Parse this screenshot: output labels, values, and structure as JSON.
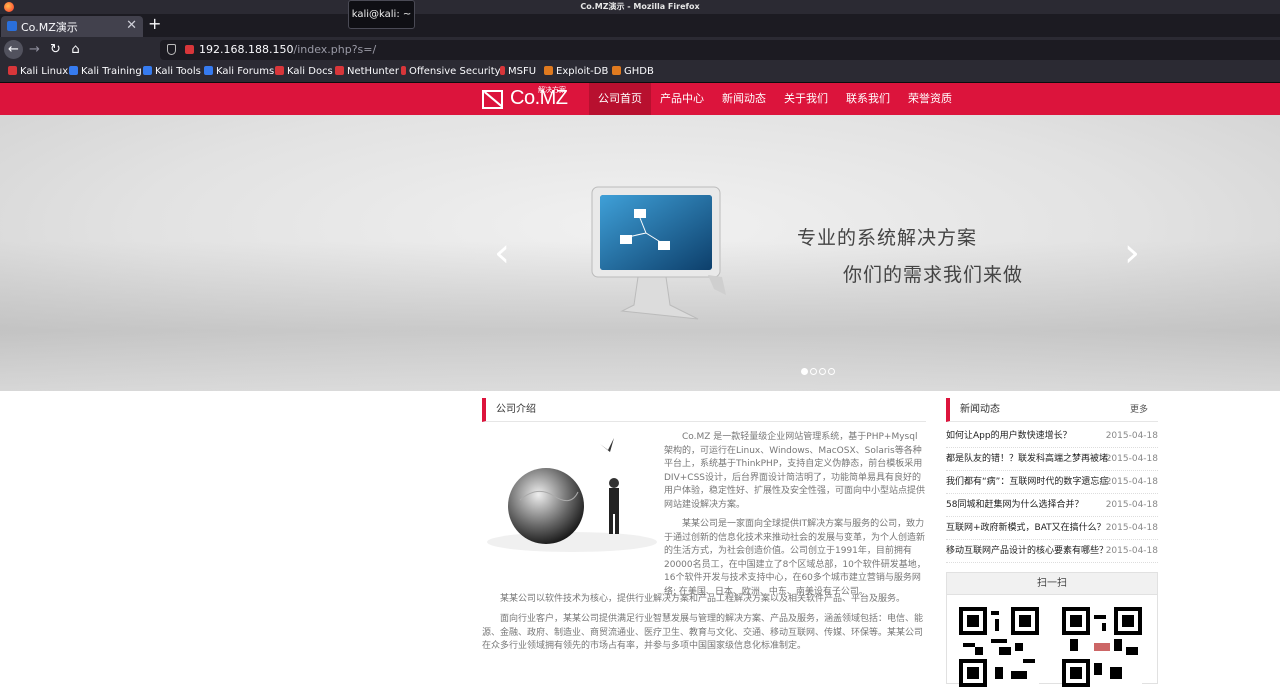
{
  "browser": {
    "window_title": "Co.MZ演示 - Mozilla Firefox",
    "tab_title": "Co.MZ演示",
    "new_tab": "+",
    "tab_close": "✕",
    "tooltip": "kali@kali: ~",
    "url_host": "192.168.188.150",
    "url_path": "/index.php?s=/",
    "bookmarks": [
      {
        "label": "Kali Linux",
        "color": "#367bf0"
      },
      {
        "label": "Kali Training",
        "color": "#367bf0"
      },
      {
        "label": "Kali Tools",
        "color": "#367bf0"
      },
      {
        "label": "Kali Forums",
        "color": "#367bf0"
      },
      {
        "label": "Kali Docs",
        "color": "#d8363a"
      },
      {
        "label": "NetHunter",
        "color": "#d8363a"
      },
      {
        "label": "Offensive Security",
        "color": "#d8363a"
      },
      {
        "label": "MSFU",
        "color": "#d8363a"
      },
      {
        "label": "Exploit-DB",
        "color": "#e07a1f"
      },
      {
        "label": "GHDB",
        "color": "#e07a1f"
      }
    ]
  },
  "site": {
    "brand_color": "#dc143c",
    "logo_text": "Co.MZ",
    "logo_sub": "解决方案",
    "menu": [
      "公司首页",
      "产品中心",
      "新闻动态",
      "关于我们",
      "联系我们",
      "荣誉资质"
    ],
    "banner": {
      "line1": "专业的系统解决方案",
      "line2": "你们的需求我们来做",
      "prev": "‹",
      "next": "›"
    },
    "intro": {
      "title": "公司介绍",
      "p1": "Co.MZ 是一款轻量级企业网站管理系统，基于PHP+Mysql架构的，可运行在Linux、Windows、MacOSX、Solaris等各种平台上，系统基于ThinkPHP，支持自定义伪静态，前台模板采用DIV+CSS设计，后台界面设计简洁明了，功能简单易具有良好的用户体验，稳定性好、扩展性及安全性强，可面向中小型站点提供网站建设解决方案。",
      "p2": "某某公司是一家面向全球提供IT解决方案与服务的公司，致力于通过创新的信息化技术来推动社会的发展与变革，为个人创造新的生活方式，为社会创造价值。公司创立于1991年，目前拥有20000名员工，在中国建立了8个区域总部，10个软件研发基地， 16个软件开发与技术支持中心，在60多个城市建立营销与服务网络; 在美国、日本、欧洲、中东、南美设有子公司。",
      "p3": "某某公司以软件技术为核心，提供行业解决方案和产品工程解决方案以及相关软件产品、平台及服务。",
      "p4": "面向行业客户，某某公司提供满足行业智慧发展与管理的解决方案、产品及服务，涵盖领域包括：电信、能源、金融、政府、制造业、商贸流通业、医疗卫生、教育与文化、交通、移动互联网、传媒、环保等。某某公司在众多行业领域拥有领先的市场占有率，并参与多项中国国家级信息化标准制定。"
    },
    "news": {
      "title": "新闻动态",
      "more": "更多",
      "items": [
        {
          "title": "如何让App的用户数快速增长？",
          "date": "2015-04-18"
        },
        {
          "title": "都是队友的错！？联发科高端之梦再被堵",
          "date": "2015-04-18"
        },
        {
          "title": "我们都有“病”：互联网时代的数字遗忘症",
          "date": "2015-04-18"
        },
        {
          "title": "58同城和赶集网为什么选择合并？",
          "date": "2015-04-18"
        },
        {
          "title": "互联网+政府新模式，BAT又在搞什么？",
          "date": "2015-04-18"
        },
        {
          "title": "移动互联网产品设计的核心要素有哪些？",
          "date": "2015-04-18"
        }
      ]
    },
    "scan": {
      "title": "扫一扫"
    }
  }
}
